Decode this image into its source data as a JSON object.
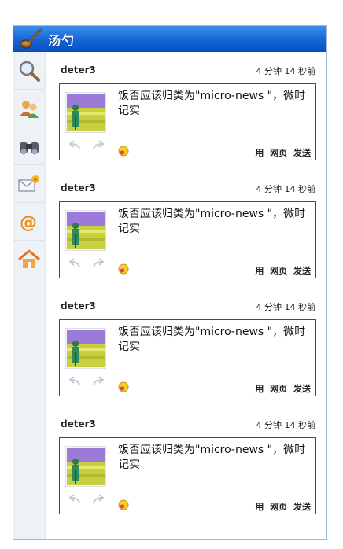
{
  "app": {
    "title": "汤勺",
    "logo_icon": "ladle-icon"
  },
  "sidebar": {
    "items": [
      {
        "name": "search",
        "icon": "magnifier-icon"
      },
      {
        "name": "friends",
        "icon": "people-icon"
      },
      {
        "name": "explore",
        "icon": "binoculars-icon"
      },
      {
        "name": "messages",
        "icon": "mail-icon"
      },
      {
        "name": "mentions",
        "icon": "at-icon"
      },
      {
        "name": "home",
        "icon": "home-icon"
      }
    ]
  },
  "posts": [
    {
      "user": "deter3",
      "time": "4 分钟 14 秒前",
      "text": "饭否应该归类为\"micro-news \"，微时记实",
      "actions": [
        "用",
        "网页",
        "发送"
      ]
    },
    {
      "user": "deter3",
      "time": "4 分钟 14 秒前",
      "text": "饭否应该归类为\"micro-news \"，微时记实",
      "actions": [
        "用",
        "网页",
        "发送"
      ]
    },
    {
      "user": "deter3",
      "time": "4 分钟 14 秒前",
      "text": "饭否应该归类为\"micro-news \"，微时记实",
      "actions": [
        "用",
        "网页",
        "发送"
      ]
    },
    {
      "user": "deter3",
      "time": "4 分钟 14 秒前",
      "text": "饭否应该归类为\"micro-news \"，微时记实",
      "actions": [
        "用",
        "网页",
        "发送"
      ]
    }
  ],
  "colors": {
    "titlebar": "#1566d8",
    "sidebar": "#eef2f6",
    "card_border": "#2c4f73"
  }
}
